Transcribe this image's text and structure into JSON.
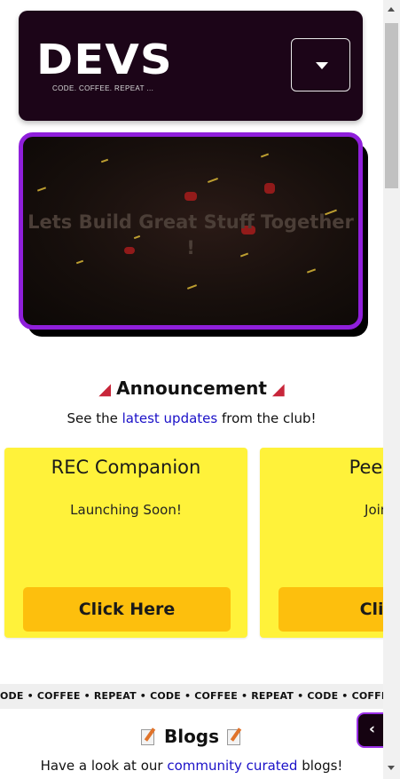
{
  "header": {
    "logo": "DEVS",
    "tagline": "CODE. COFFEE. REPEAT ...",
    "menu_icon": "caret-down-icon"
  },
  "hero": {
    "text": "Lets Build Great Stuff Together !",
    "border_color": "#8f1fdb"
  },
  "announcement": {
    "title": "Announcement",
    "icon": "megaphone-icon",
    "subtitle_before": "See the ",
    "subtitle_link": "latest updates",
    "subtitle_after": " from the club!",
    "cards": [
      {
        "title": "REC Companion",
        "description": "Launching Soon!",
        "button": "Click Here"
      },
      {
        "title": "Peer-To",
        "description": "Join t",
        "button": "Click"
      }
    ],
    "card_color": "#fff23a",
    "button_color": "#fdbf0d"
  },
  "marquee": {
    "text": "ODE • COFFEE • REPEAT • CODE • COFFEE • REPEAT • CODE • COFFEE • REPEAT"
  },
  "blogs": {
    "title": "Blogs",
    "icon": "memo-icon",
    "subtitle_before": "Have a look at our ",
    "subtitle_link": "community curated",
    "subtitle_after": " blogs!"
  },
  "side_tab": {
    "label": "‹"
  },
  "colors": {
    "header_bg": "#1c0518",
    "link": "#1a10c8"
  }
}
